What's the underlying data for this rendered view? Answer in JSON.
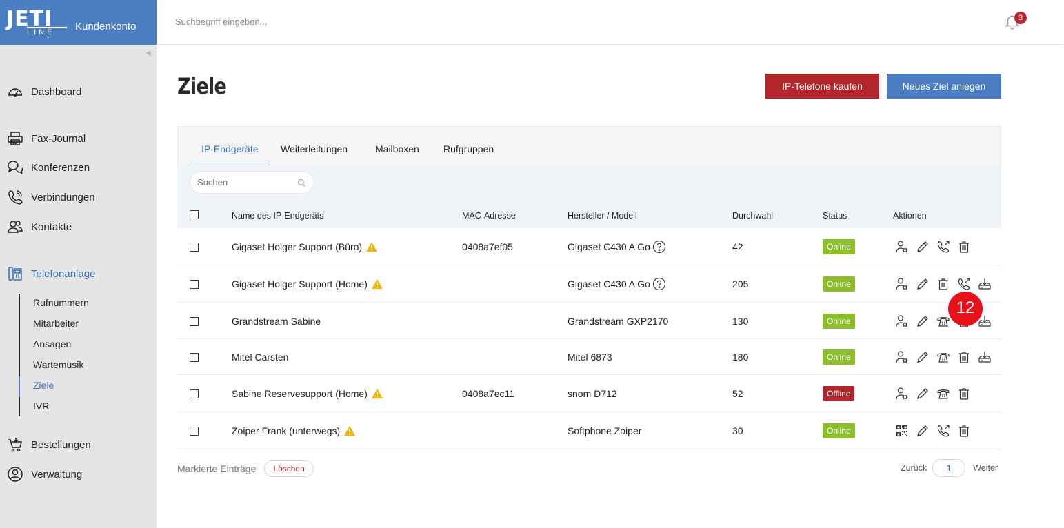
{
  "brand": {
    "logo_main": "JETI",
    "logo_sub": "LINE",
    "subtitle": "Kundenkonto"
  },
  "topbar": {
    "search_placeholder": "Suchbegriff eingeben...",
    "notification_count": "3"
  },
  "sidebar": {
    "items": [
      {
        "label": "Dashboard",
        "icon": "dashboard-icon"
      },
      {
        "label": "Fax-Journal",
        "icon": "printer-icon"
      },
      {
        "label": "Konferenzen",
        "icon": "chat-icon"
      },
      {
        "label": "Verbindungen",
        "icon": "phone-icon"
      },
      {
        "label": "Kontakte",
        "icon": "contacts-icon"
      },
      {
        "label": "Telefonanlage",
        "icon": "desk-phone-icon",
        "active": true
      },
      {
        "label": "Bestellungen",
        "icon": "cart-icon"
      },
      {
        "label": "Verwaltung",
        "icon": "user-circle-icon"
      }
    ],
    "subitems": [
      "Rufnummern",
      "Mitarbeiter",
      "Ansagen",
      "Wartemusik",
      "Ziele",
      "IVR"
    ],
    "active_subitem": "Ziele"
  },
  "page": {
    "title": "Ziele",
    "buy_button": "IP-Telefone kaufen",
    "new_button": "Neues Ziel anlegen"
  },
  "tabs": [
    "IP-Endgeräte",
    "Weiterleitungen",
    "Mailboxen",
    "Rufgruppen"
  ],
  "active_tab": "IP-Endgeräte",
  "search_placeholder": "Suchen",
  "table": {
    "columns": [
      "Name des IP-Endgeräts",
      "MAC-Adresse",
      "Hersteller / Modell",
      "Durchwahl",
      "Status",
      "Aktionen"
    ],
    "rows": [
      {
        "name": "Gigaset Holger Support (Büro)",
        "warning": true,
        "mac": "0408a7ef05",
        "model": "Gigaset C430 A Go",
        "help": true,
        "ext": "42",
        "status": "Online",
        "actions": [
          "user-settings-icon",
          "pencil-icon",
          "phone-forward-icon",
          "trash-icon"
        ]
      },
      {
        "name": "Gigaset Holger Support (Home)",
        "warning": true,
        "mac": "",
        "model": "Gigaset C430 A Go",
        "help": true,
        "ext": "205",
        "status": "Online",
        "actions": [
          "user-settings-icon",
          "pencil-icon",
          "trash-icon",
          "phone-forward-icon",
          "provision-icon"
        ]
      },
      {
        "name": "Grandstream Sabine",
        "warning": false,
        "mac": "",
        "model": "Grandstream GXP2170",
        "help": false,
        "ext": "130",
        "status": "Online",
        "actions": [
          "user-settings-icon",
          "pencil-icon",
          "desk-phone-icon",
          "trash-icon",
          "provision-icon"
        ]
      },
      {
        "name": "Mitel Carsten",
        "warning": false,
        "mac": "",
        "model": "Mitel 6873",
        "help": false,
        "ext": "180",
        "status": "Online",
        "actions": [
          "user-settings-icon",
          "pencil-icon",
          "desk-phone-icon",
          "trash-icon",
          "provision-icon"
        ]
      },
      {
        "name": "Sabine Reservesupport (Home)",
        "warning": true,
        "mac": "0408a7ec11",
        "model": "snom D712",
        "help": false,
        "ext": "52",
        "status": "Offline",
        "actions": [
          "user-settings-icon",
          "pencil-icon",
          "desk-phone-icon",
          "trash-icon"
        ]
      },
      {
        "name": "Zoiper Frank (unterwegs)",
        "warning": true,
        "mac": "",
        "model": "Softphone Zoiper",
        "help": false,
        "ext": "30",
        "status": "Online",
        "actions": [
          "qr-code-icon",
          "pencil-icon",
          "phone-forward-icon",
          "trash-icon"
        ]
      }
    ]
  },
  "footer": {
    "marked_label": "Markierte Einträge",
    "delete_button": "Löschen",
    "prev": "Zurück",
    "page": "1",
    "next": "Weiter"
  },
  "overlay_badge": "12",
  "colors": {
    "brand_blue": "#4a7dc2",
    "danger_red": "#b3262b",
    "online_green": "#8dbf2a"
  }
}
